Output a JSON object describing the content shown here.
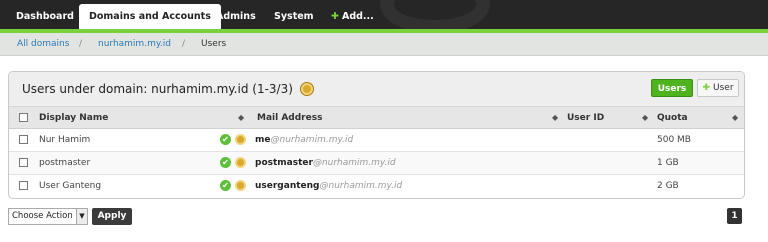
{
  "nav": {
    "tabs": [
      "Dashboard",
      "Domains and Accounts",
      "Admins",
      "System",
      "Add..."
    ],
    "active": "Domains and Accounts"
  },
  "breadcrumb": {
    "items": [
      "All domains",
      "nurhamim.my.id",
      "Users"
    ],
    "separator": "/"
  },
  "panel": {
    "title": "Users under domain: nurhamim.my.id (1-3/3)",
    "btn_users": "Users",
    "btn_add_user": "User"
  },
  "table": {
    "headers": [
      "Display Name",
      "Mail Address",
      "User ID",
      "Quota"
    ],
    "rows": [
      {
        "display_name": "Nur Hamim",
        "user": "me",
        "domain": "@nurhamim.my.id",
        "user_id": "",
        "quota": "500 MB"
      },
      {
        "display_name": "postmaster",
        "user": "postmaster",
        "domain": "@nurhamim.my.id",
        "user_id": "",
        "quota": "1 GB"
      },
      {
        "display_name": "User Ganteng",
        "user": "userganteng",
        "domain": "@nurhamim.my.id",
        "user_id": "",
        "quota": "2 GB"
      }
    ]
  },
  "actions": {
    "select_value": "Choose Action",
    "apply": "Apply"
  },
  "pager": {
    "current": "1"
  },
  "colors": {
    "accent": "#7ad13c",
    "button_green": "#4fb21f",
    "nav_bg": "#262626"
  }
}
